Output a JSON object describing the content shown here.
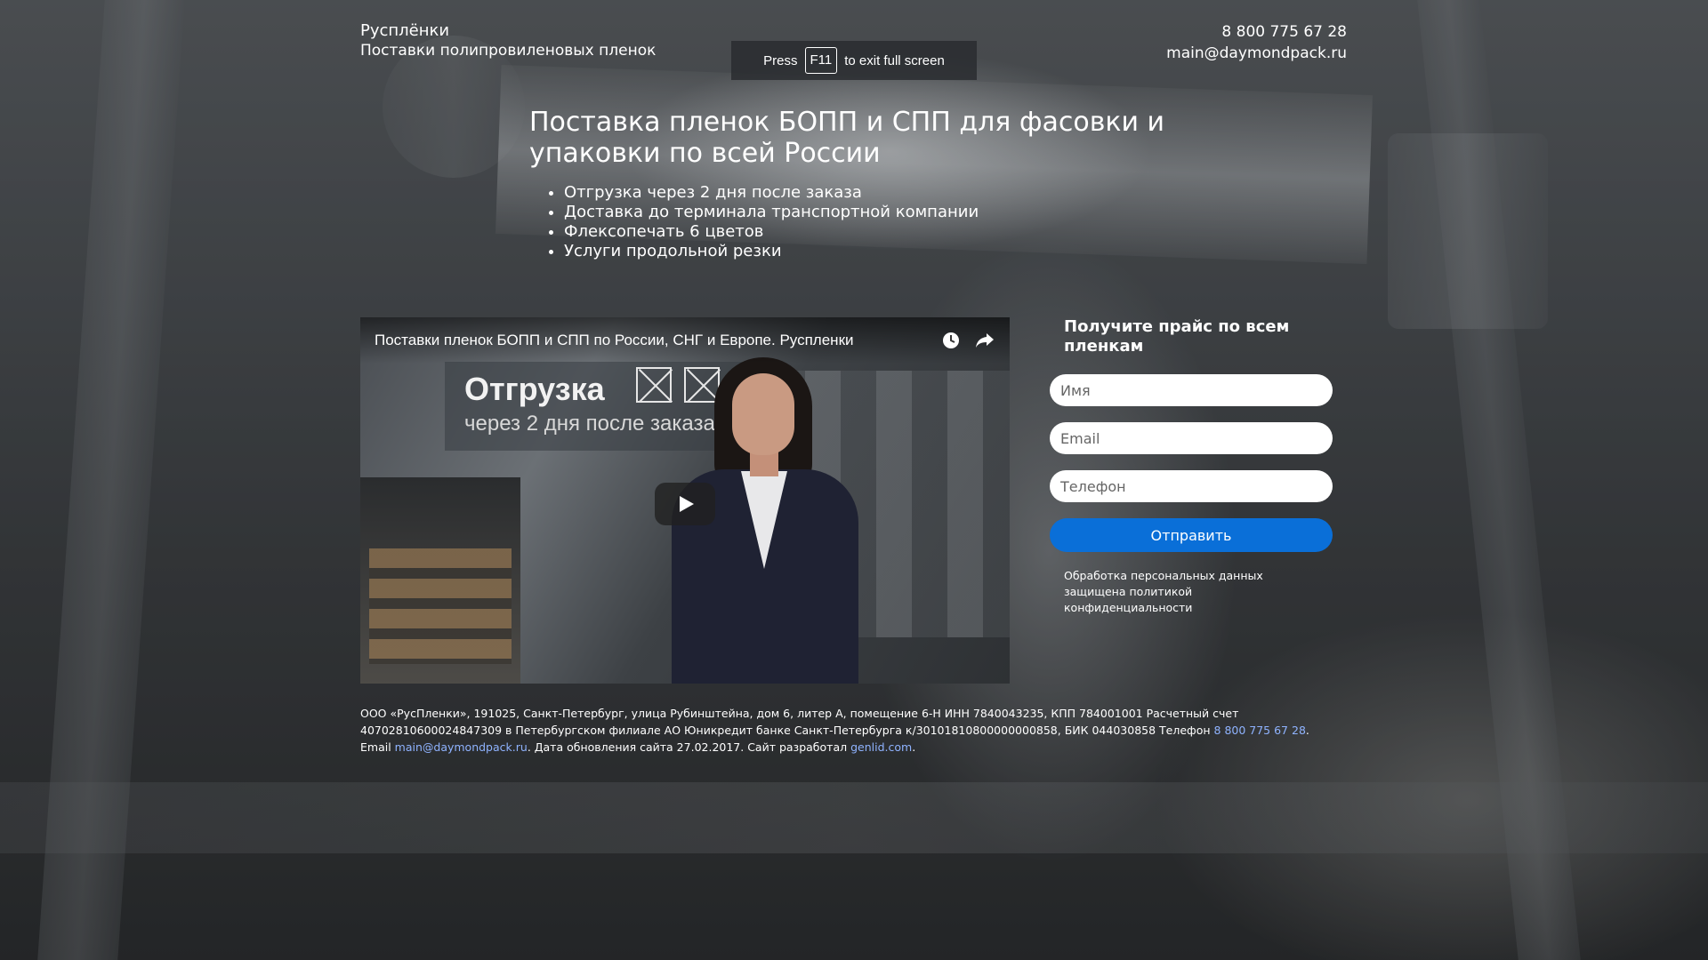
{
  "header": {
    "brand_name": "Руcплёнки",
    "brand_tagline": "Поставки полипровиленовых пленок",
    "phone": "8 800 775 67 28",
    "email": "main@daymondpack.ru"
  },
  "fullscreen_notice": {
    "press": "Press",
    "key": "F11",
    "suffix": "to exit full screen"
  },
  "hero": {
    "title": "Поставка пленок БОПП и СПП для фасовки и упаковки по всей России",
    "benefits": [
      "Отгрузка через 2 дня после заказа",
      "Доставка до терминала транспортной компании",
      "Флексопечать 6 цветов",
      "Услуги продольной резки"
    ]
  },
  "video": {
    "title": "Поставки пленок БОПП и СПП по России, СНГ и Европе. Руспленки",
    "caption_title": "Отгрузка",
    "caption_subtitle": "через 2 дня после заказа",
    "icons": [
      "clock-icon",
      "share-icon",
      "play-icon"
    ]
  },
  "form": {
    "title": "Получите прайс по всем пленкам",
    "name_placeholder": "Имя",
    "email_placeholder": "Email",
    "phone_placeholder": "Телефон",
    "submit_label": "Отправить",
    "privacy_text": "Обработка персональных данных защищена политикой конфиденциальности"
  },
  "footer": {
    "text_1": "ООО «РусПленки», 191025, Санкт-Петербург, улица Рубинштейна, дом 6, литер А, помещение 6-Н ИНН 7840043235, КПП 784001001 Расчетный счет 40702810600024847309 в Петербургском филиале АО Юникредит банке Санкт-Петербурга к/30101810800000000858, БИК 044030858 Телефон ",
    "phone_link": "8 800 775 67 28",
    "text_2": ".",
    "email_prefix": "Email ",
    "email_link": "main@daymondpack.ru",
    "text_3": ". Дата обновления сайта 27.02.2017. Сайт разработал ",
    "dev_link": "genlid.com",
    "text_4": "."
  },
  "colors": {
    "accent": "#0a6fd8",
    "link": "#8fb3ff"
  }
}
